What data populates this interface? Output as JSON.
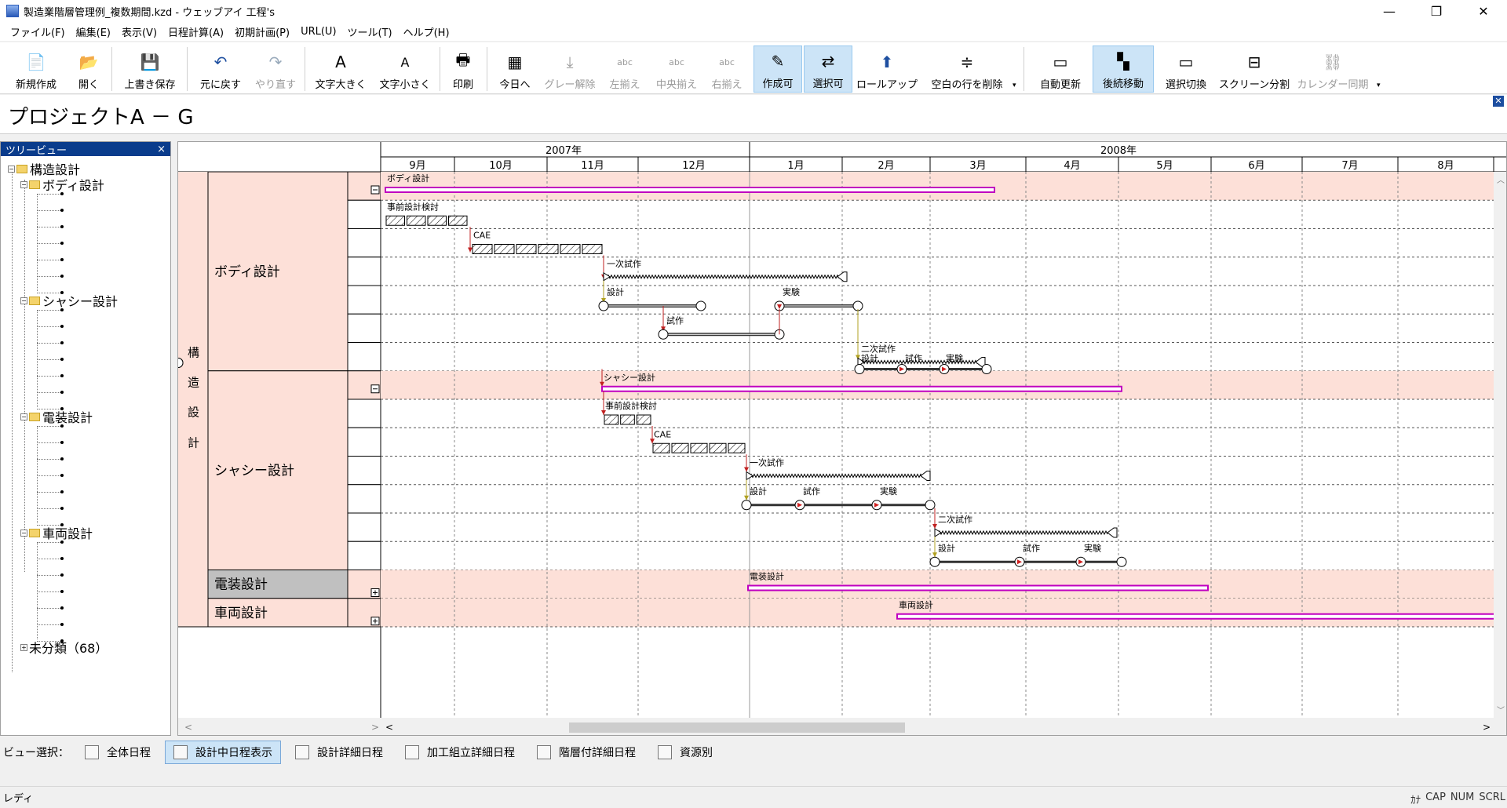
{
  "window": {
    "title": "製造業階層管理例_複数期間.kzd - ウェッブアイ 工程's",
    "min": "—",
    "restore": "❐",
    "close": "✕"
  },
  "menu": [
    "ファイル(F)",
    "編集(E)",
    "表示(V)",
    "日程計算(A)",
    "初期計画(P)",
    "URL(U)",
    "ツール(T)",
    "ヘルプ(H)"
  ],
  "toolbar": {
    "new": "新規作成",
    "open": "開く",
    "save": "上書き保存",
    "undo": "元に戻す",
    "redo": "やり直す",
    "font_up": "文字大きく",
    "font_down": "文字小さく",
    "print": "印刷",
    "today": "今日へ",
    "ungray": "グレー解除",
    "align_left": "左揃え",
    "align_center": "中央揃え",
    "align_right": "右揃え",
    "create": "作成可",
    "select": "選択可",
    "rollup": "ロールアップ",
    "delete_empty": "空白の行を削除",
    "auto_update": "自動更新",
    "follow_move": "後続移動",
    "select_switch": "選択切換",
    "split_screen": "スクリーン分割",
    "calendar_sync": "カレンダー同期"
  },
  "project_title": "プロジェクトA － G",
  "tree": {
    "header": "ツリービュー",
    "close": "×",
    "root": "構造設計",
    "groups": [
      "ボディ設計",
      "シャシー設計",
      "電装設計",
      "車両設計"
    ],
    "uncategorized": "未分類（68）"
  },
  "gantt": {
    "years": [
      "2007年",
      "2008年"
    ],
    "months": [
      "9月",
      "10月",
      "11月",
      "12月",
      "1月",
      "2月",
      "3月",
      "4月",
      "5月",
      "6月",
      "7月",
      "8月"
    ],
    "category": "構造設計",
    "groups": [
      "ボディ設計",
      "シャシー設計",
      "電装設計",
      "車両設計"
    ],
    "tasks": {
      "body_summary": "ボディ設計",
      "body_pre": "事前設計検討",
      "body_cae": "CAE",
      "body_proto1": "一次試作",
      "body_design": "設計",
      "body_exp": "実験",
      "body_trial": "試作",
      "body_proto2": "二次試作",
      "body_design2": "設計",
      "body_trial2": "試作",
      "body_exp2": "実験",
      "chassis_summary": "シャシー設計",
      "chassis_pre": "事前設計検討",
      "chassis_cae": "CAE",
      "chassis_proto1": "一次試作",
      "chassis_design": "設計",
      "chassis_trial": "試作",
      "chassis_exp": "実験",
      "chassis_proto2": "二次試作",
      "chassis_design2": "設計",
      "chassis_trial2": "試作",
      "chassis_exp2": "実験",
      "elec_summary": "電装設計",
      "vehicle_summary": "車両設計"
    }
  },
  "views": {
    "label": "ビュー選択：",
    "tabs": [
      "全体日程",
      "設計中日程表示",
      "設計詳細日程",
      "加工組立詳細日程",
      "階層付詳細日程",
      "資源別"
    ]
  },
  "status": {
    "text": "レディ",
    "indicators": [
      "ｶﾅ",
      "CAP",
      "NUM",
      "SCRL"
    ]
  },
  "colors": {
    "accent": "#c000c0",
    "row_pink": "#fde0d8",
    "selected_row": "#c0c0c0",
    "tree_header": "#0a3c8c"
  }
}
